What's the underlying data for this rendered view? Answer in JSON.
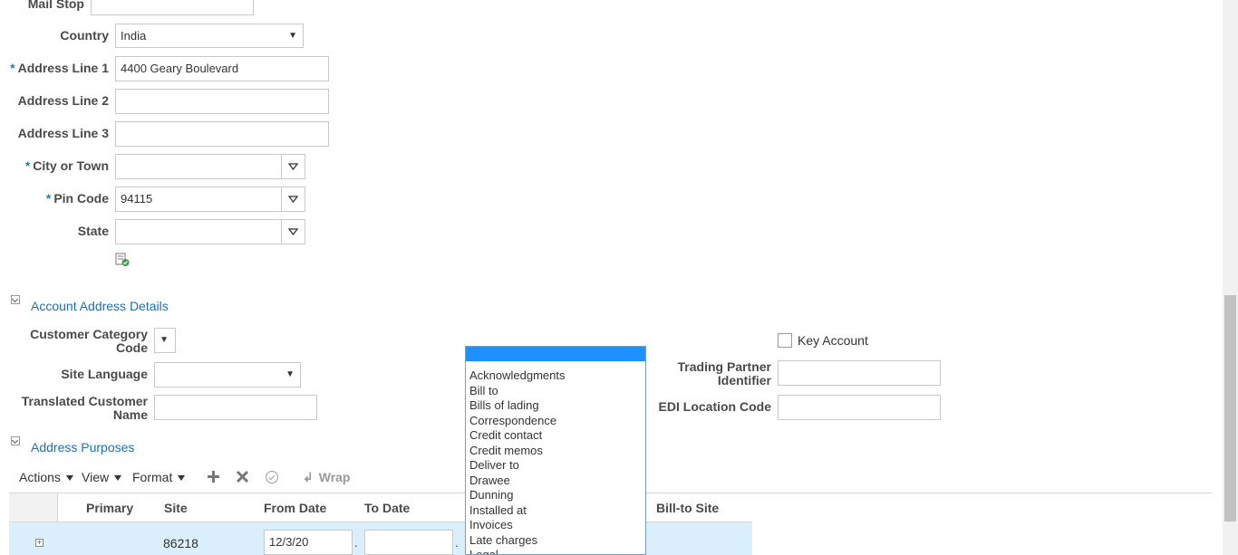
{
  "address": {
    "mail_stop_label": "Mail Stop",
    "country_label": "Country",
    "country_value": "India",
    "address1_label": "Address Line 1",
    "address1_value": "4400 Geary Boulevard",
    "address2_label": "Address Line 2",
    "address3_label": "Address Line 3",
    "city_label": "City or Town",
    "pin_label": "Pin Code",
    "pin_value": "94115",
    "state_label": "State",
    "required_mark": "*"
  },
  "account_section": {
    "title": "Account Address Details",
    "customer_category_label": "Customer Category Code",
    "site_language_label": "Site Language",
    "translated_name_label": "Translated Customer Name",
    "key_account_label": "Key Account",
    "trading_partner_label": "Trading Partner Identifier",
    "edi_label": "EDI Location Code"
  },
  "purposes_section": {
    "title": "Address Purposes",
    "toolbar": {
      "actions": "Actions",
      "view": "View",
      "format": "Format",
      "wrap": "Wrap"
    },
    "columns": [
      "Primary",
      "Site",
      "From Date",
      "To Date",
      "Bill-to Site"
    ],
    "row": {
      "site": "86218",
      "from_date": "12/3/20"
    }
  },
  "purpose_dropdown": {
    "options": [
      "Acknowledgments",
      "Bill to",
      "Bills of lading",
      "Correspondence",
      "Credit contact",
      "Credit memos",
      "Deliver to",
      "Drawee",
      "Dunning",
      "Installed at",
      "Invoices",
      "Late charges",
      "Legal"
    ]
  },
  "colors": {
    "link": "#1f6fb5",
    "selection": "#1e90ff",
    "row_highlight": "#daeefb"
  }
}
